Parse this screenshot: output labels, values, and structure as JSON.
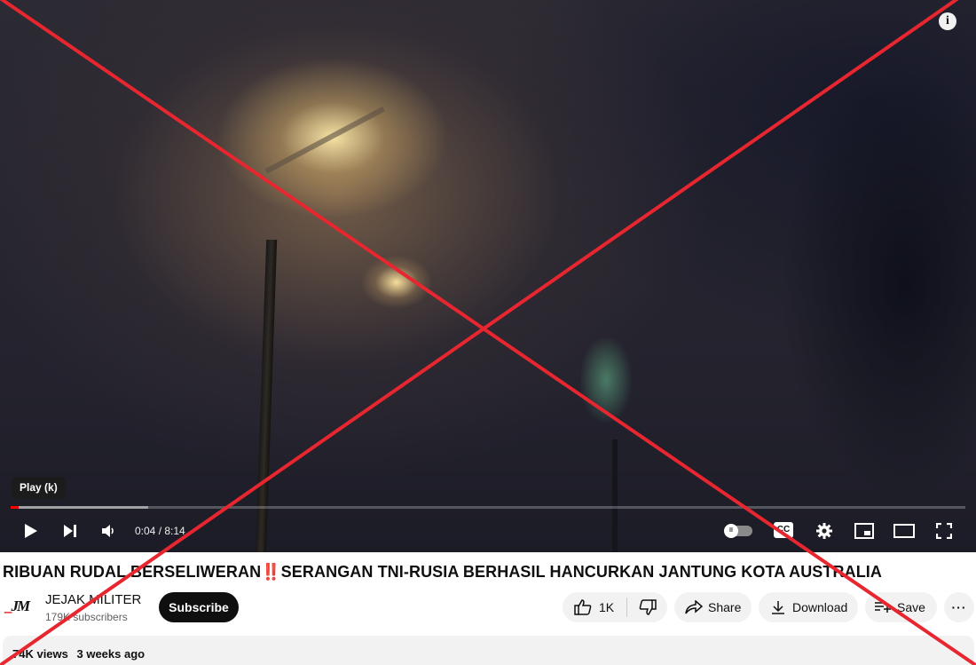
{
  "player": {
    "tooltip": "Play (k)",
    "time_display": "0:04 / 8:14",
    "progress": {
      "played_fraction": 0.0084,
      "loaded_fraction": 0.144
    },
    "info_glyph": "i",
    "cc_label": "CC",
    "icons": {
      "play": "play-icon",
      "next": "next-icon",
      "volume": "volume-icon",
      "autoplay": "autoplay-toggle-icon",
      "subtitles": "subtitles-icon",
      "settings": "settings-gear-icon",
      "miniplayer": "miniplayer-icon",
      "theater": "theater-mode-icon",
      "fullscreen": "fullscreen-icon"
    }
  },
  "video": {
    "title": "RIBUAN RUDAL BERSELIWERAN‼️SERANGAN TNI-RUSIA BERHASIL HANCURKAN JANTUNG KOTA AUSTRALIA"
  },
  "channel": {
    "logo_text": "JM",
    "name": "JEJAK MILITER",
    "subscribers": "179K subscribers",
    "subscribe_label": "Subscribe"
  },
  "actions": {
    "like_count": "1K",
    "share_label": "Share",
    "download_label": "Download",
    "save_label": "Save",
    "more_label": "···"
  },
  "description": {
    "views": "74K views",
    "age": "3 weeks ago"
  },
  "overlay": {
    "type": "red-cross",
    "color": "#e8262f"
  }
}
